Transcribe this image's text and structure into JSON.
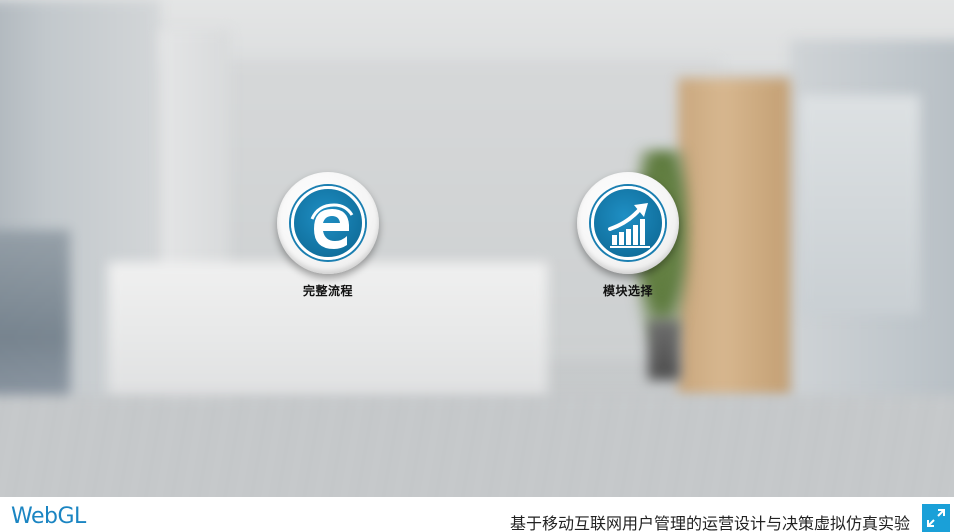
{
  "menu": {
    "full_process_label": "完整流程",
    "full_process_icon": "edge-e-icon",
    "module_select_label": "模块选择",
    "module_select_icon": "growth-chart-icon"
  },
  "footer": {
    "logo": "WebGL",
    "title": "基于移动互联网用户管理的运营设计与决策虚拟仿真实验",
    "fullscreen_icon": "fullscreen-icon"
  },
  "colors": {
    "accent": "#1b85c2",
    "icon_ring": "#11719f",
    "fullscreen_bg": "#1aa0d8"
  }
}
